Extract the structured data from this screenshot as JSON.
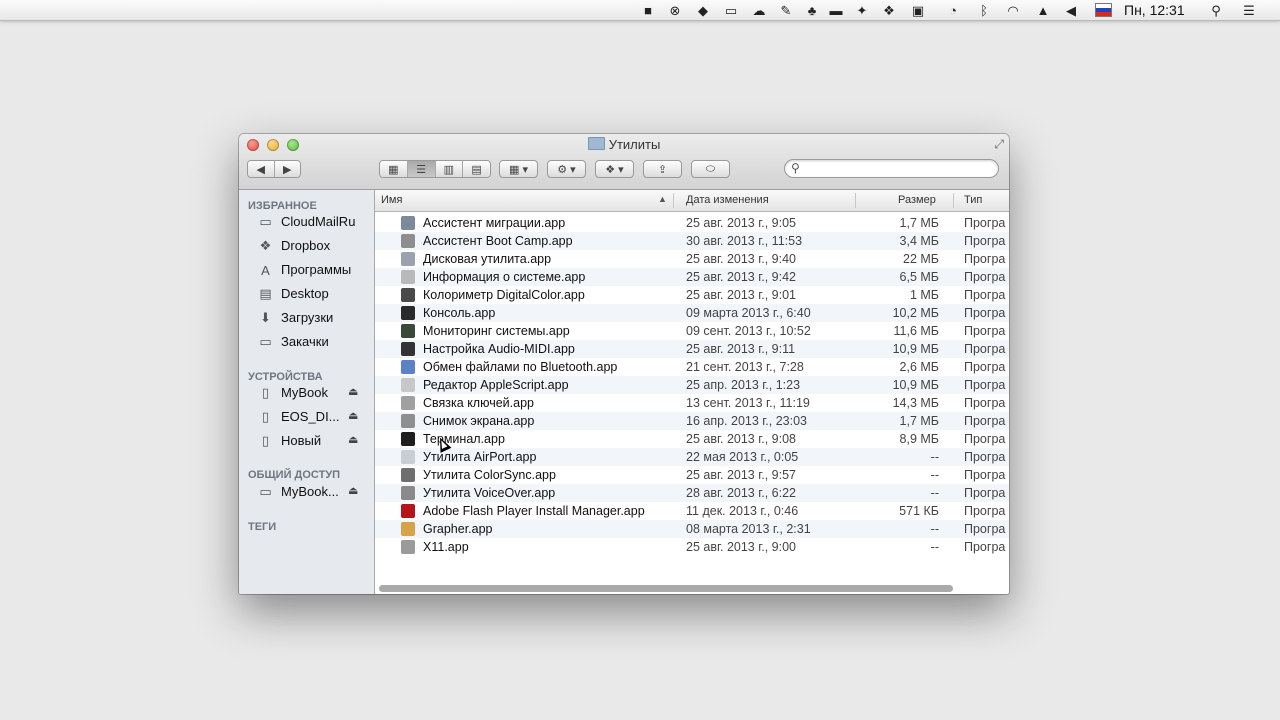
{
  "menubar": {
    "time": "Пн, 12:31",
    "icons": [
      "video-camera-icon",
      "x-circle-icon",
      "app-icon",
      "display-icon",
      "cloud-icon",
      "wrench-icon",
      "evernote-icon",
      "chat-icon",
      "dropbox-icon",
      "screen-icon",
      "time-machine-icon",
      "bluetooth-icon",
      "wifi-icon",
      "eject-icon",
      "volume-icon",
      "flag-icon",
      "search-icon",
      "menu-list-icon"
    ]
  },
  "window": {
    "title": "Утилиты",
    "search_placeholder": ""
  },
  "sidebar": {
    "favorites_header": "ИЗБРАННОЕ",
    "favorites": [
      {
        "label": "CloudMailRu",
        "icon": "folder-icon"
      },
      {
        "label": "Dropbox",
        "icon": "dropbox-icon"
      },
      {
        "label": "Программы",
        "icon": "applications-icon"
      },
      {
        "label": "Desktop",
        "icon": "desktop-icon"
      },
      {
        "label": "Загрузки",
        "icon": "downloads-icon"
      },
      {
        "label": "Закачки",
        "icon": "folder-icon"
      }
    ],
    "devices_header": "УСТРОЙСТВА",
    "devices": [
      {
        "label": "MyBook",
        "icon": "disk-icon"
      },
      {
        "label": "EOS_DI...",
        "icon": "disk-icon"
      },
      {
        "label": "Новый",
        "icon": "disk-icon"
      }
    ],
    "shared_header": "ОБЩИЙ ДОСТУП",
    "shared": [
      {
        "label": "MyBook...",
        "icon": "network-computer-icon"
      }
    ],
    "tags_header": "ТЕГИ"
  },
  "columns": {
    "name": "Имя",
    "date": "Дата изменения",
    "size": "Размер",
    "type": "Тип"
  },
  "files": [
    {
      "name": "Ассистент миграции.app",
      "date": "25 авг. 2013 г., 9:05",
      "size": "1,7 МБ",
      "type": "Програ",
      "color": "#7d8a99"
    },
    {
      "name": "Ассистент Boot Camp.app",
      "date": "30 авг. 2013 г., 11:53",
      "size": "3,4 МБ",
      "type": "Програ",
      "color": "#8e8e8e"
    },
    {
      "name": "Дисковая утилита.app",
      "date": "25 авг. 2013 г., 9:40",
      "size": "22 МБ",
      "type": "Програ",
      "color": "#9aa3ad"
    },
    {
      "name": "Информация о системе.app",
      "date": "25 авг. 2013 г., 9:42",
      "size": "6,5 МБ",
      "type": "Програ",
      "color": "#b9b9b9"
    },
    {
      "name": "Колориметр DigitalColor.app",
      "date": "25 авг. 2013 г., 9:01",
      "size": "1 МБ",
      "type": "Програ",
      "color": "#4a4a4a"
    },
    {
      "name": "Консоль.app",
      "date": "09 марта 2013 г., 6:40",
      "size": "10,2 МБ",
      "type": "Програ",
      "color": "#2b2b2b"
    },
    {
      "name": "Мониторинг системы.app",
      "date": "09 сент. 2013 г., 10:52",
      "size": "11,6 МБ",
      "type": "Програ",
      "color": "#3a4a3a"
    },
    {
      "name": "Настройка Audio-MIDI.app",
      "date": "25 авг. 2013 г., 9:11",
      "size": "10,9 МБ",
      "type": "Програ",
      "color": "#333333"
    },
    {
      "name": "Обмен файлами по Bluetooth.app",
      "date": "21 сент. 2013 г., 7:28",
      "size": "2,6 МБ",
      "type": "Програ",
      "color": "#5b82c4"
    },
    {
      "name": "Редактор AppleScript.app",
      "date": "25 апр. 2013 г., 1:23",
      "size": "10,9 МБ",
      "type": "Програ",
      "color": "#c7c7c7"
    },
    {
      "name": "Связка ключей.app",
      "date": "13 сент. 2013 г., 11:19",
      "size": "14,3 МБ",
      "type": "Програ",
      "color": "#a0a0a0"
    },
    {
      "name": "Снимок экрана.app",
      "date": "16 апр. 2013 г., 23:03",
      "size": "1,7 МБ",
      "type": "Програ",
      "color": "#8f8f8f"
    },
    {
      "name": "Терминал.app",
      "date": "25 авг. 2013 г., 9:08",
      "size": "8,9 МБ",
      "type": "Програ",
      "color": "#1e1e1e"
    },
    {
      "name": "Утилита AirPort.app",
      "date": "22 мая 2013 г., 0:05",
      "size": "--",
      "type": "Програ",
      "color": "#c9ced6"
    },
    {
      "name": "Утилита ColorSync.app",
      "date": "25 авг. 2013 г., 9:57",
      "size": "--",
      "type": "Програ",
      "color": "#6f6f6f"
    },
    {
      "name": "Утилита VoiceOver.app",
      "date": "28 авг. 2013 г., 6:22",
      "size": "--",
      "type": "Програ",
      "color": "#8a8a8a"
    },
    {
      "name": "Adobe Flash Player Install Manager.app",
      "date": "11 дек. 2013 г., 0:46",
      "size": "571 КБ",
      "type": "Програ",
      "color": "#b3151b"
    },
    {
      "name": "Grapher.app",
      "date": "08 марта 2013 г., 2:31",
      "size": "--",
      "type": "Програ",
      "color": "#d6a24a"
    },
    {
      "name": "X11.app",
      "date": "25 авг. 2013 г., 9:00",
      "size": "--",
      "type": "Програ",
      "color": "#9a9a9a"
    }
  ]
}
